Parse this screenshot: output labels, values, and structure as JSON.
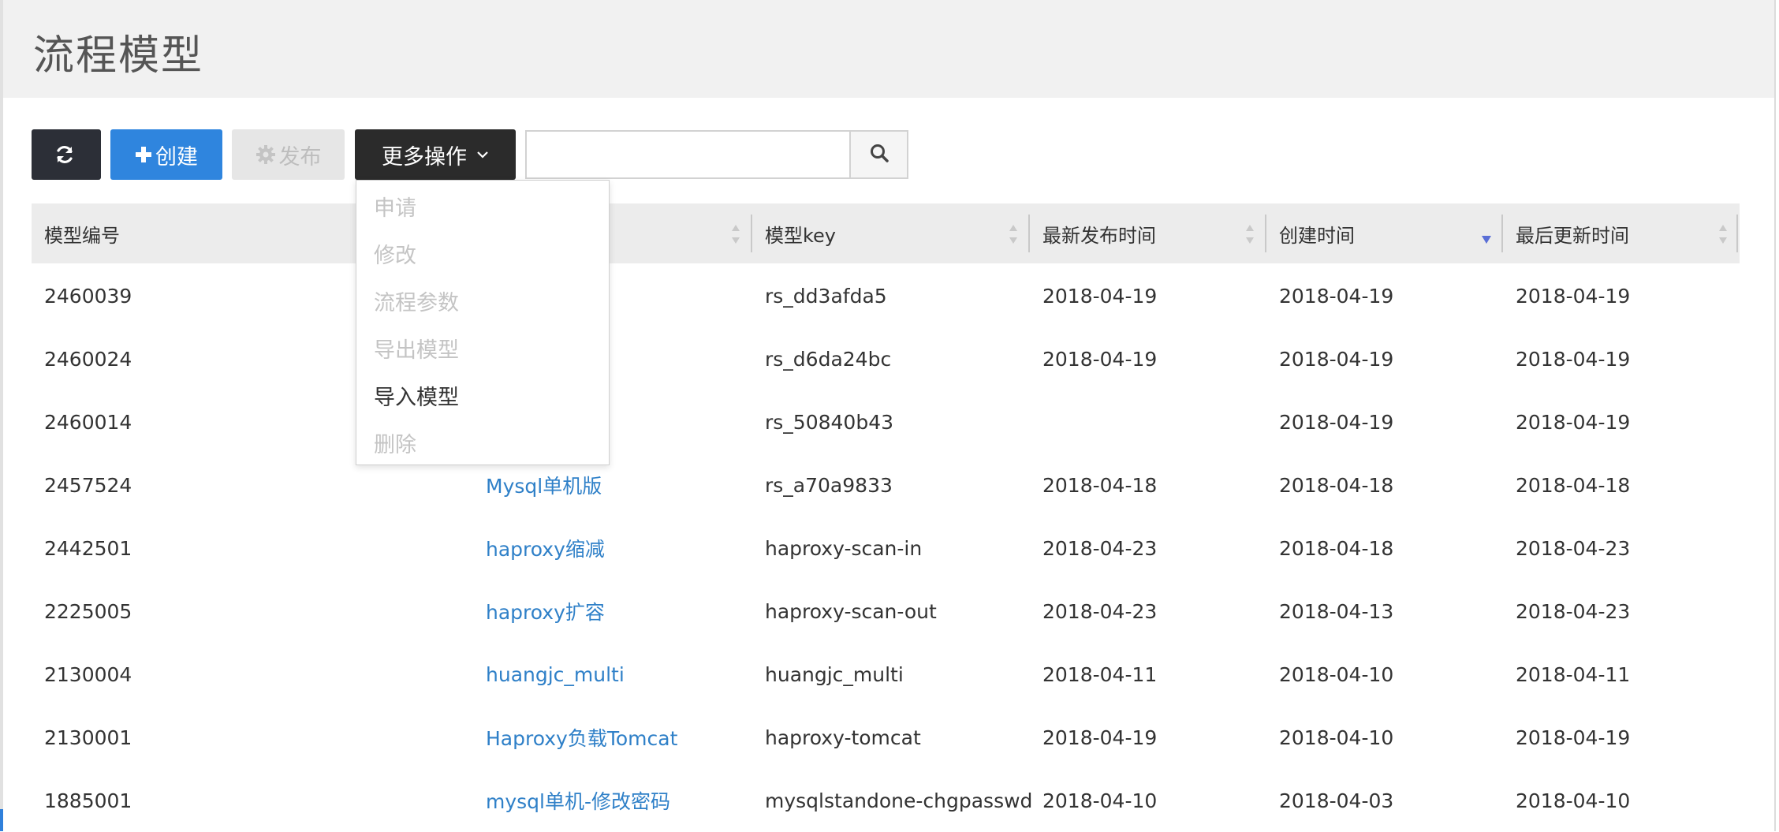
{
  "page": {
    "title": "流程模型"
  },
  "toolbar": {
    "create_label": "创建",
    "publish_label": "发布",
    "more_label": "更多操作",
    "search_placeholder": ""
  },
  "dropdown": {
    "items": [
      {
        "label": "申请",
        "enabled": false
      },
      {
        "label": "修改",
        "enabled": false
      },
      {
        "label": "流程参数",
        "enabled": false
      },
      {
        "label": "导出模型",
        "enabled": false
      },
      {
        "label": "导入模型",
        "enabled": true
      },
      {
        "label": "删除",
        "enabled": false
      }
    ]
  },
  "table": {
    "columns": [
      {
        "label": "模型编号",
        "sortable": false
      },
      {
        "label": "",
        "sortable": true
      },
      {
        "label": "模型key",
        "sortable": true
      },
      {
        "label": "最新发布时间",
        "sortable": true
      },
      {
        "label": "创建时间",
        "sortable": true,
        "sorted": "desc"
      },
      {
        "label": "最后更新时间",
        "sortable": true
      }
    ],
    "rows": [
      {
        "id": "2460039",
        "name": "",
        "key": "rs_dd3afda5",
        "published": "2018-04-19",
        "created": "2018-04-19",
        "updated": "2018-04-19"
      },
      {
        "id": "2460024",
        "name": "",
        "key": "rs_d6da24bc",
        "published": "2018-04-19",
        "created": "2018-04-19",
        "updated": "2018-04-19"
      },
      {
        "id": "2460014",
        "name": "",
        "key": "rs_50840b43",
        "published": "",
        "created": "2018-04-19",
        "updated": "2018-04-19"
      },
      {
        "id": "2457524",
        "name": "Mysql单机版",
        "key": "rs_a70a9833",
        "published": "2018-04-18",
        "created": "2018-04-18",
        "updated": "2018-04-18"
      },
      {
        "id": "2442501",
        "name": "haproxy缩减",
        "key": "haproxy-scan-in",
        "published": "2018-04-23",
        "created": "2018-04-18",
        "updated": "2018-04-23"
      },
      {
        "id": "2225005",
        "name": "haproxy扩容",
        "key": "haproxy-scan-out",
        "published": "2018-04-23",
        "created": "2018-04-13",
        "updated": "2018-04-23"
      },
      {
        "id": "2130004",
        "name": "huangjc_multi",
        "key": "huangjc_multi",
        "published": "2018-04-11",
        "created": "2018-04-10",
        "updated": "2018-04-11"
      },
      {
        "id": "2130001",
        "name": "Haproxy负载Tomcat",
        "key": "haproxy-tomcat",
        "published": "2018-04-19",
        "created": "2018-04-10",
        "updated": "2018-04-19"
      },
      {
        "id": "1885001",
        "name": "mysql单机-修改密码",
        "key": "mysqlstandone-chgpasswd",
        "published": "2018-04-10",
        "created": "2018-04-03",
        "updated": "2018-04-10"
      }
    ]
  },
  "colors": {
    "primary": "#2f85de",
    "dark": "#2c2f37",
    "link": "#2f80c8",
    "sort_active": "#5a6fd6"
  },
  "icons": {
    "refresh": "refresh-icon",
    "create": "plus-icon",
    "publish": "gear-icon",
    "more": "chevron-down-icon",
    "search": "search-icon"
  }
}
